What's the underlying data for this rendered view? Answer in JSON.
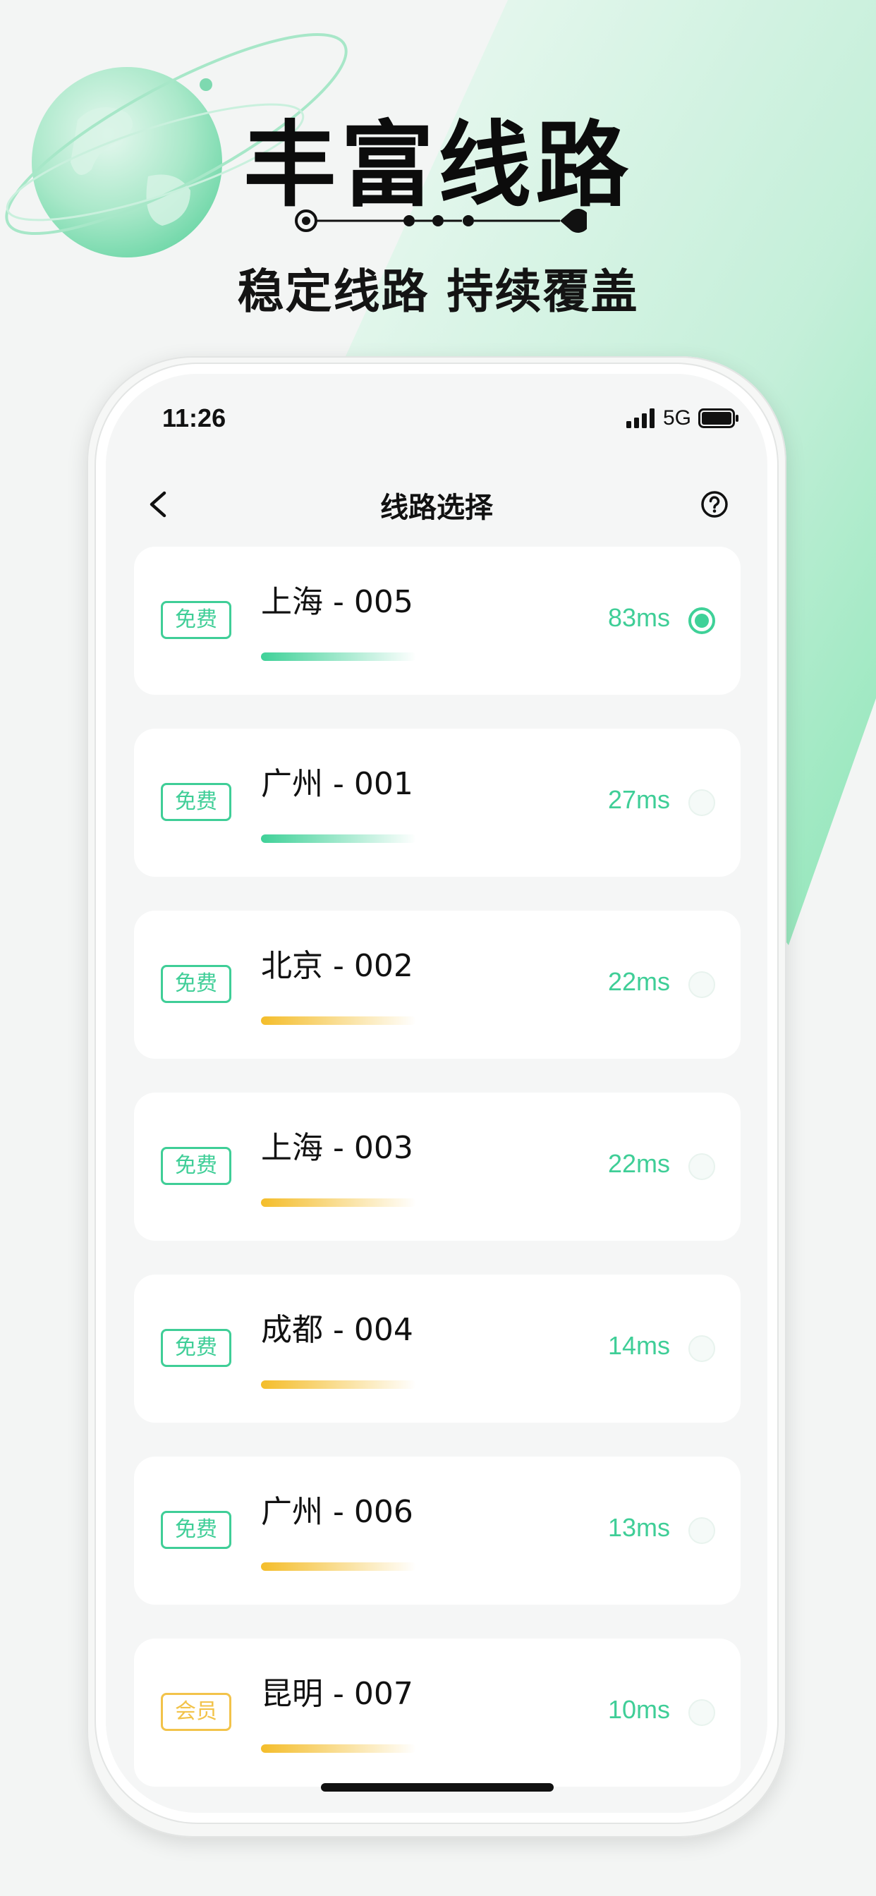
{
  "promo": {
    "headline": "丰富线路",
    "subline": "稳定线路 持续覆盖"
  },
  "status_bar": {
    "time": "11:26",
    "network": "5G"
  },
  "nav": {
    "title": "线路选择"
  },
  "routes": [
    {
      "tag": "免费",
      "tag_type": "free",
      "name": "上海 - 005",
      "latency": "83ms",
      "selected": true,
      "bar_color": "green"
    },
    {
      "tag": "免费",
      "tag_type": "free",
      "name": "广州 - 001",
      "latency": "27ms",
      "selected": false,
      "bar_color": "green"
    },
    {
      "tag": "免费",
      "tag_type": "free",
      "name": "北京 - 002",
      "latency": "22ms",
      "selected": false,
      "bar_color": "gold"
    },
    {
      "tag": "免费",
      "tag_type": "free",
      "name": "上海 - 003",
      "latency": "22ms",
      "selected": false,
      "bar_color": "gold"
    },
    {
      "tag": "免费",
      "tag_type": "free",
      "name": "成都 - 004",
      "latency": "14ms",
      "selected": false,
      "bar_color": "gold"
    },
    {
      "tag": "免费",
      "tag_type": "free",
      "name": "广州 - 006",
      "latency": "13ms",
      "selected": false,
      "bar_color": "gold"
    },
    {
      "tag": "会员",
      "tag_type": "vip",
      "name": "昆明 - 007",
      "latency": "10ms",
      "selected": false,
      "bar_color": "gold"
    }
  ],
  "colors": {
    "accent_green": "#3fce97",
    "accent_gold": "#f2c34a"
  }
}
